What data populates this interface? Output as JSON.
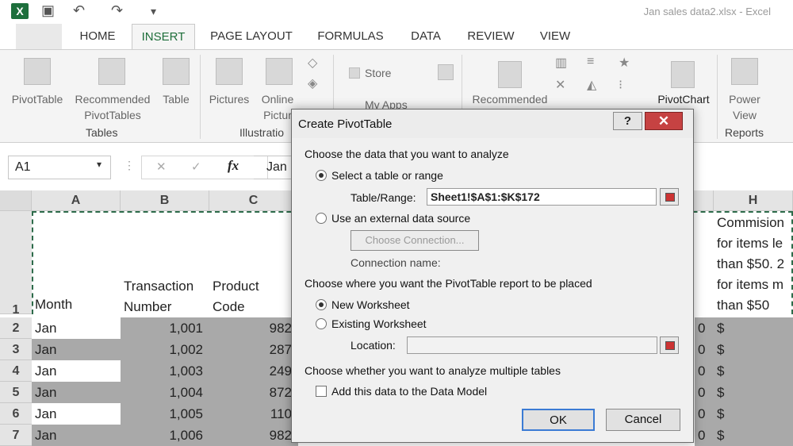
{
  "app": {
    "logo": "X",
    "window_title": "Jan sales data2.xlsx - Excel"
  },
  "ribbon_tabs": [
    "HOME",
    "INSERT",
    "PAGE LAYOUT",
    "FORMULAS",
    "DATA",
    "REVIEW",
    "VIEW"
  ],
  "ribbon": {
    "pivottable": "PivotTable",
    "recommended_pivottables_1": "Recommended",
    "recommended_pivottables_2": "PivotTables",
    "table": "Table",
    "pictures": "Pictures",
    "online_pictures_1": "Online",
    "online_pictures_2": "Pictur",
    "store": "Store",
    "my_apps": "My Apps",
    "recommended_charts": "Recommended",
    "pivotchart": "PivotChart",
    "power_view_1": "Power",
    "power_view_2": "View",
    "group_tables": "Tables",
    "group_illustrations": "Illustratio",
    "group_reports": "Reports"
  },
  "formula_bar": {
    "name_box": "A1",
    "fx": "fx",
    "formula": "Jan"
  },
  "grid": {
    "columns": [
      "A",
      "B",
      "C",
      "H"
    ],
    "header_row": {
      "month": "Month",
      "transaction_1": "Transaction",
      "transaction_2": "Number",
      "product_1": "Product",
      "product_2": "Code",
      "commission": [
        "Commision",
        "for items le",
        "than $50. 2",
        "for items m",
        "than $50"
      ]
    },
    "row_numbers": [
      "1",
      "2",
      "3",
      "4",
      "5",
      "6",
      "7"
    ],
    "rows": [
      {
        "month": "Jan",
        "transaction": "1,001",
        "product": "982",
        "g": "0",
        "h": "$"
      },
      {
        "month": "Jan",
        "transaction": "1,002",
        "product": "287",
        "g": "0",
        "h": "$"
      },
      {
        "month": "Jan",
        "transaction": "1,003",
        "product": "249",
        "g": "0",
        "h": "$"
      },
      {
        "month": "Jan",
        "transaction": "1,004",
        "product": "872",
        "g": "0",
        "h": "$"
      },
      {
        "month": "Jan",
        "transaction": "1,005",
        "product": "110",
        "g": "0",
        "h": "$"
      },
      {
        "month": "Jan",
        "transaction": "1,006",
        "product": "982",
        "g": "0",
        "h": "$"
      }
    ]
  },
  "dialog": {
    "title": "Create PivotTable",
    "help": "?",
    "close": "✕",
    "section1": "Choose the data that you want to analyze",
    "opt_select_table": "Select a table or range",
    "table_range_label": "Table/Range:",
    "table_range_value": "Sheet1!$A$1:$K$172",
    "opt_external": "Use an external data source",
    "choose_connection": "Choose Connection...",
    "connection_name": "Connection name:",
    "section2": "Choose where you want the PivotTable report to be placed",
    "opt_new_ws": "New Worksheet",
    "opt_existing_ws": "Existing Worksheet",
    "location_label": "Location:",
    "section3": "Choose whether you want to analyze multiple tables",
    "add_data_model": "Add this data to the Data Model",
    "ok": "OK",
    "cancel": "Cancel"
  }
}
